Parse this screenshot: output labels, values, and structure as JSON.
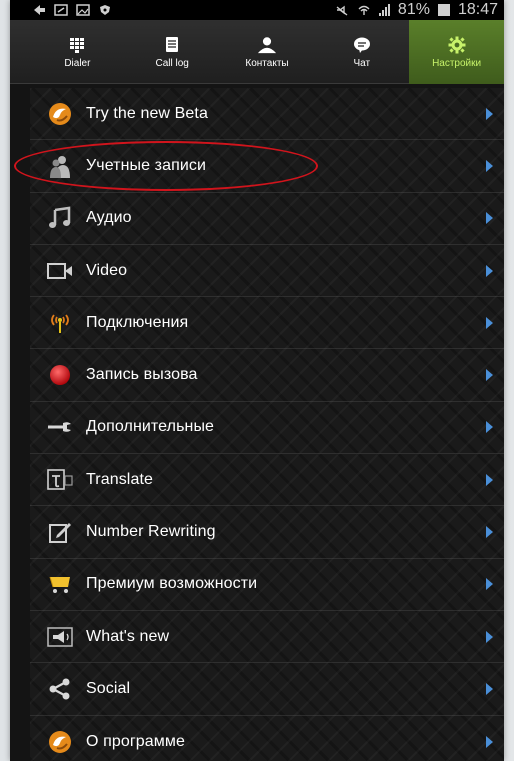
{
  "status_bar": {
    "battery_text": "81%",
    "time": "18:47",
    "icons": [
      "back-arrow-icon",
      "screenshot-icon",
      "image-icon",
      "shield-icon",
      "mute-icon",
      "wifi-icon",
      "signal-icon",
      "battery-icon"
    ]
  },
  "tabs": [
    {
      "label": "Dialer",
      "icon": "dialpad-icon",
      "active": false
    },
    {
      "label": "Call log",
      "icon": "call-log-icon",
      "active": false
    },
    {
      "label": "Контакты",
      "icon": "contacts-icon",
      "active": false
    },
    {
      "label": "Чат",
      "icon": "chat-icon",
      "active": false
    },
    {
      "label": "Настройки",
      "icon": "gear-icon",
      "active": true
    }
  ],
  "colors": {
    "accent_green": "#c7f26a",
    "active_tab_bg": "#4a6b22",
    "arrow_blue": "#4a8fd8",
    "highlight_red": "#d1141c"
  },
  "menu": {
    "items": [
      {
        "label": "Try the new Beta",
        "icon": "app-logo-icon"
      },
      {
        "label": "Учетные записи",
        "icon": "accounts-icon"
      },
      {
        "label": "Аудио",
        "icon": "music-note-icon"
      },
      {
        "label": "Video",
        "icon": "video-camera-icon"
      },
      {
        "label": "Подключения",
        "icon": "antenna-icon"
      },
      {
        "label": "Запись вызова",
        "icon": "record-icon"
      },
      {
        "label": "Дополнительные",
        "icon": "wrench-icon"
      },
      {
        "label": "Translate",
        "icon": "translate-icon"
      },
      {
        "label": "Number Rewriting",
        "icon": "edit-icon"
      },
      {
        "label": "Премиум возможности",
        "icon": "cart-icon"
      },
      {
        "label": "What's new",
        "icon": "megaphone-icon"
      },
      {
        "label": "Social",
        "icon": "share-icon"
      },
      {
        "label": "О программе",
        "icon": "app-logo-icon"
      }
    ]
  }
}
